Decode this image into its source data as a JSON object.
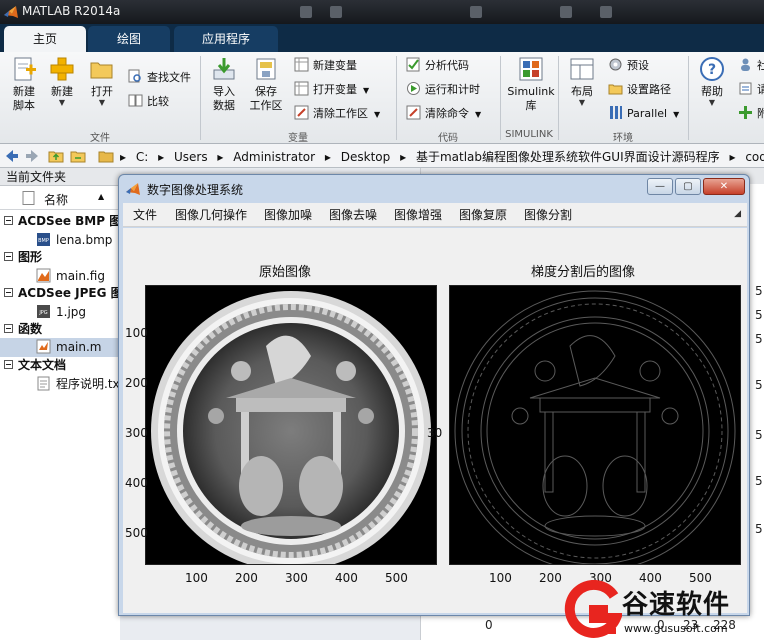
{
  "app": {
    "title": "MATLAB R2014a"
  },
  "ribbon_tabs": [
    "主页",
    "绘图",
    "应用程序"
  ],
  "ribbon": {
    "file_group": {
      "label": "文件",
      "buttons": [
        "新建\n脚本",
        "新建",
        "打开"
      ],
      "small": [
        "查找文件",
        "比较"
      ]
    },
    "variable_group": {
      "label": "变量",
      "buttons": [
        "导入\n数据",
        "保存\n工作区"
      ],
      "small": [
        "新建变量",
        "打开变量",
        "清除工作区"
      ]
    },
    "code_group": {
      "label": "代码",
      "small": [
        "分析代码",
        "运行和计时",
        "清除命令"
      ]
    },
    "simulink_group": {
      "label": "SIMULINK",
      "button": "Simulink\n库"
    },
    "env_group": {
      "label": "环境",
      "button": "布局",
      "small": [
        "预设",
        "设置路径",
        "Parallel"
      ]
    },
    "resources_group": {
      "help_button": "帮助",
      "small": [
        "社",
        "请",
        "附"
      ]
    }
  },
  "address": [
    "C:",
    "Users",
    "Administrator",
    "Desktop",
    "基于matlab编程图像处理系统软件GUI界面设计源码程序",
    "code"
  ],
  "current_folder": {
    "title": "当前文件夹",
    "column_name": "名称",
    "rows": [
      {
        "type": "group",
        "text": "ACDSee BMP 图"
      },
      {
        "type": "file",
        "text": "lena.bmp",
        "icon": "bmp-file-icon"
      },
      {
        "type": "group",
        "text": "图形"
      },
      {
        "type": "file",
        "text": "main.fig",
        "icon": "fig-file-icon"
      },
      {
        "type": "group",
        "text": "ACDSee JPEG 图"
      },
      {
        "type": "file",
        "text": "1.jpg",
        "icon": "jpg-file-icon"
      },
      {
        "type": "group",
        "text": "函数"
      },
      {
        "type": "file",
        "text": "main.m",
        "icon": "m-file-icon",
        "selected": true
      },
      {
        "type": "group",
        "text": "文本文档"
      },
      {
        "type": "file",
        "text": "程序说明.txt",
        "icon": "txt-file-icon"
      }
    ]
  },
  "gui": {
    "title": "数字图像处理系统",
    "menu": [
      "文件",
      "图像几何操作",
      "图像加噪",
      "图像去噪",
      "图像增强",
      "图像复原",
      "图像分割"
    ],
    "left_axes": {
      "title": "原始图像",
      "xticks": [
        "100",
        "200",
        "300",
        "400",
        "500"
      ],
      "yticks": [
        "100",
        "200",
        "300",
        "400",
        "500"
      ]
    },
    "right_axes": {
      "title": "梯度分割后的图像",
      "xticks": [
        "100",
        "200",
        "300",
        "400",
        "500"
      ],
      "yticks": [
        "30"
      ]
    }
  },
  "background_numbers": [
    "5",
    "5",
    "5",
    "5",
    "5",
    "5",
    "5",
    "0",
    "0",
    "0",
    "23",
    "228"
  ],
  "watermark": {
    "brand": "谷速软件",
    "url": "www.gususoft.com"
  }
}
